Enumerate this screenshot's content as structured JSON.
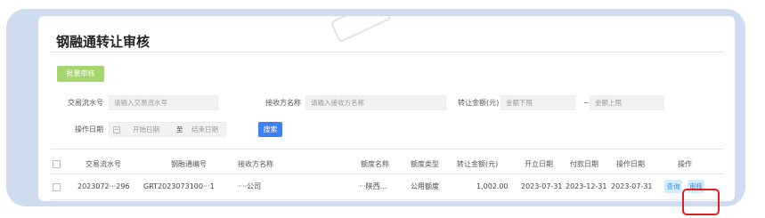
{
  "page": {
    "title": "钢融通转让审核"
  },
  "toolbar": {
    "batch_audit_label": "批量审核"
  },
  "filters": {
    "serial_label": "交易流水号",
    "serial_placeholder": "请输入交易流水号",
    "receiver_label": "接收方名称",
    "receiver_placeholder": "请输入接收方名称",
    "amount_label": "转让金额(元)",
    "amount_min_placeholder": "金额下限",
    "range_sep": "~",
    "amount_max_placeholder": "金额上限",
    "date_label": "操作日期",
    "date_start_placeholder": "开始日期",
    "date_sep": "至",
    "date_end_placeholder": "结束日期",
    "search_label": "搜索"
  },
  "table": {
    "headers": {
      "serial": "交易流水号",
      "code": "钢融通编号",
      "receiver": "接收方名称",
      "quota_name": "额度名称",
      "quota_type": "额度类型",
      "amount": "转让金额(元)",
      "open_date": "开立日期",
      "pay_date": "付款日期",
      "op_date": "操作日期",
      "actions": "操作"
    },
    "rows": [
      {
        "serial": "2023072···296",
        "code": "GRT2023073100···1",
        "receiver": "····公司",
        "quota_name": "···陕西...",
        "quota_type": "公用额度",
        "amount": "1,002.00",
        "open_date": "2023-07-31",
        "pay_date": "2023-12-31",
        "op_date": "2023-07-31",
        "view_label": "查询",
        "audit_label": "审核"
      }
    ]
  },
  "colors": {
    "frame": "#cfdcf0",
    "batch_button": "#a5d66e",
    "search_button": "#3d7ff5",
    "link_button_bg": "#d6ebfd",
    "highlight": "#e02020"
  }
}
